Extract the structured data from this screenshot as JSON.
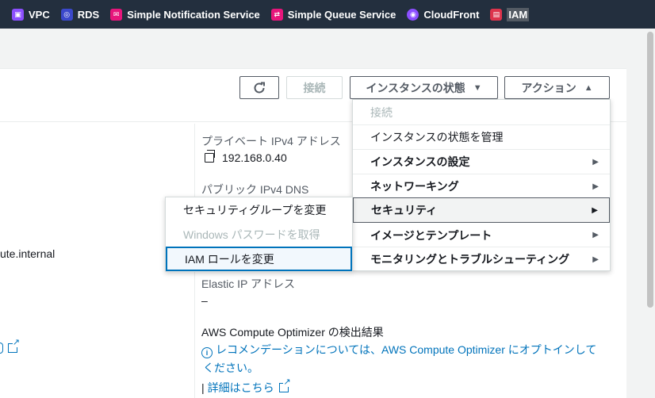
{
  "favorites": [
    {
      "label": "VPC",
      "icon": "vpc-icon",
      "color": "#8c4fff"
    },
    {
      "label": "RDS",
      "icon": "rds-icon",
      "color": "#3b48cc"
    },
    {
      "label": "Simple Notification Service",
      "icon": "sns-icon",
      "color": "#e7157b"
    },
    {
      "label": "Simple Queue Service",
      "icon": "sqs-icon",
      "color": "#e7157b"
    },
    {
      "label": "CloudFront",
      "icon": "cloudfront-icon",
      "color": "#8c4fff"
    },
    {
      "label": "IAM",
      "icon": "iam-icon",
      "color": "#dd344c"
    }
  ],
  "toolbar": {
    "refresh_icon": "refresh-icon",
    "connect_label": "接続",
    "instance_state_label": "インスタンスの状態",
    "actions_label": "アクション"
  },
  "details": {
    "private_ip_label": "プライベート IPv4 アドレス",
    "private_ip_value": "192.168.0.40",
    "public_dns_label": "パブリック IPv4 DNS",
    "left_partial_value": "ute.internal",
    "elastic_ip_label": "Elastic IP アドレス",
    "elastic_ip_value": "–",
    "optimizer_label": "AWS Compute Optimizer の検出結果",
    "optimizer_text_1": "レコメンデーションについては、AWS Compute Optimizer にオプトインして",
    "optimizer_text_2": "ください。",
    "learn_more": "詳細はこちら"
  },
  "actions_menu": [
    {
      "label": "接続",
      "state": "disabled",
      "submenu": false
    },
    {
      "label": "インスタンスの状態を管理",
      "state": "normal",
      "submenu": false
    },
    {
      "label": "インスタンスの設定",
      "state": "bold",
      "submenu": true
    },
    {
      "label": "ネットワーキング",
      "state": "bold",
      "submenu": true
    },
    {
      "label": "セキュリティ",
      "state": "highlighted",
      "submenu": true
    },
    {
      "label": "イメージとテンプレート",
      "state": "bold",
      "submenu": true
    },
    {
      "label": "モニタリングとトラブルシューティング",
      "state": "bold",
      "submenu": true
    }
  ],
  "security_submenu": [
    {
      "label": "セキュリティグループを変更",
      "state": "normal"
    },
    {
      "label": "Windows パスワードを取得",
      "state": "disabled"
    },
    {
      "label": "IAM ロールを変更",
      "state": "focused"
    }
  ],
  "colors": {
    "nav_bg": "#232f3e",
    "link": "#0073bb",
    "disabled": "#aab7b8"
  }
}
